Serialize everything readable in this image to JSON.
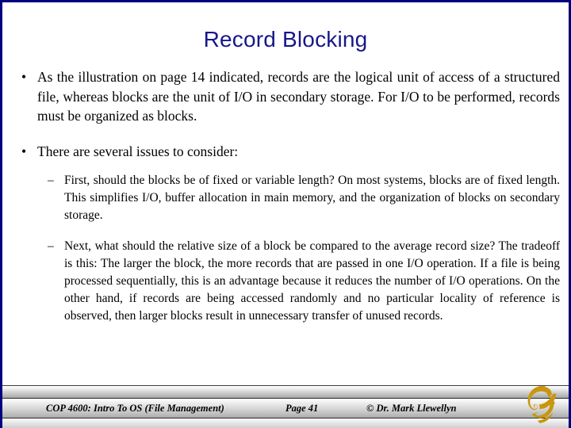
{
  "slide": {
    "title": "Record Blocking",
    "accent_color": "#17178B",
    "border_color": "#000080",
    "background_color": "#FFFFFF",
    "body_text_color": "#000000"
  },
  "content": {
    "bullets": [
      {
        "level": 1,
        "marker": "•",
        "text": "As the illustration on page 14 indicated, records are the logical unit of access of a structured file, whereas blocks are the unit of I/O in secondary storage.  For I/O to be performed, records must be organized as blocks."
      },
      {
        "level": 1,
        "marker": "•",
        "text": "There are several issues to consider:"
      },
      {
        "level": 2,
        "marker": "–",
        "text": "First, should the blocks be of fixed or variable length?  On most systems, blocks are of fixed length.  This simplifies I/O, buffer allocation in main memory, and the organization of blocks on secondary storage."
      },
      {
        "level": 2,
        "marker": "–",
        "text": "Next, what should the relative size of a block be compared to the average record size?  The tradeoff is this: The larger the block, the more records that are passed in one I/O operation.  If a file is being processed sequentially, this is an advantage because it reduces the number of I/O operations.  On the other hand, if records are being accessed randomly and no particular locality of reference is observed, then larger blocks result in unnecessary transfer of unused records."
      }
    ]
  },
  "footer": {
    "course": "COP 4600: Intro To OS  (File Management)",
    "page": "Page 41",
    "copyright": "© Dr. Mark Llewellyn",
    "logo_name": "ucf-pegasus-logo",
    "logo_color": "#C8960F"
  }
}
